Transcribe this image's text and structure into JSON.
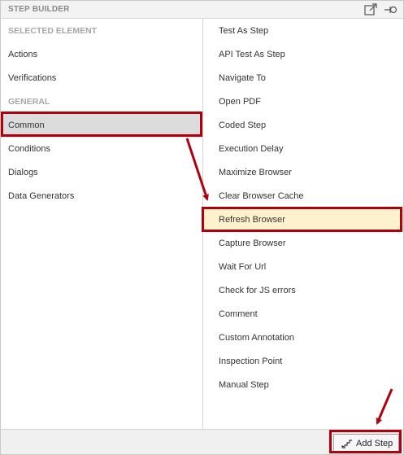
{
  "window": {
    "title": "STEP BUILDER",
    "icons": [
      "popout-icon",
      "pin-icon"
    ]
  },
  "left_panel": {
    "sections": [
      {
        "header": "SELECTED ELEMENT",
        "items": [
          "Actions",
          "Verifications"
        ]
      },
      {
        "header": "GENERAL",
        "items": [
          "Common",
          "Conditions",
          "Dialogs",
          "Data Generators"
        ]
      }
    ],
    "selected": "Common"
  },
  "right_panel": {
    "items": [
      "Test As Step",
      "API Test As Step",
      "Navigate To",
      "Open PDF",
      "Coded Step",
      "Execution Delay",
      "Maximize Browser",
      "Clear Browser Cache",
      "Refresh Browser",
      "Capture Browser",
      "Wait For Url",
      "Check for JS errors",
      "Comment",
      "Custom Annotation",
      "Inspection Point",
      "Manual Step"
    ],
    "highlighted": "Refresh Browser"
  },
  "footer": {
    "add_step_label": "Add Step",
    "add_step_icon": "step-stairs-icon"
  },
  "colors": {
    "annotation_red": "#b0000e",
    "selected_bg": "#dcdcdc",
    "highlight_bg": "#fff2cc",
    "section_header": "#a7a7a7"
  }
}
